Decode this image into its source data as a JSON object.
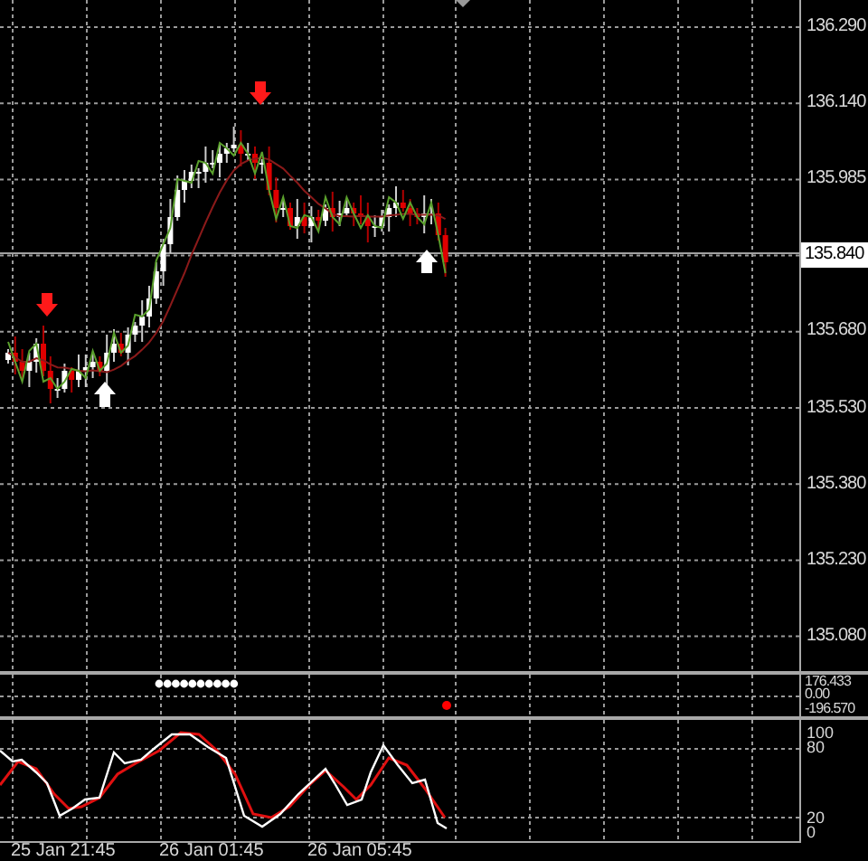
{
  "price_axis": {
    "labels": [
      {
        "text": "136.290",
        "kind": "grid"
      },
      {
        "text": "136.140",
        "kind": "grid"
      },
      {
        "text": "135.985",
        "kind": "grid"
      },
      {
        "text": "135.840",
        "kind": "current"
      },
      {
        "text": "135.680",
        "kind": "grid"
      },
      {
        "text": "135.530",
        "kind": "grid"
      },
      {
        "text": "135.380",
        "kind": "grid"
      },
      {
        "text": "135.230",
        "kind": "grid"
      },
      {
        "text": "135.080",
        "kind": "grid"
      }
    ]
  },
  "signal_pane": {
    "labels": [
      "176.433",
      "0.00",
      "-196.570"
    ]
  },
  "stochastic_pane": {
    "labels": [
      "100",
      "80",
      "20",
      "0"
    ]
  },
  "time_axis": {
    "labels": [
      "25 Jan 21:45",
      "26 Jan 01:45",
      "26 Jan 05:45"
    ]
  }
}
